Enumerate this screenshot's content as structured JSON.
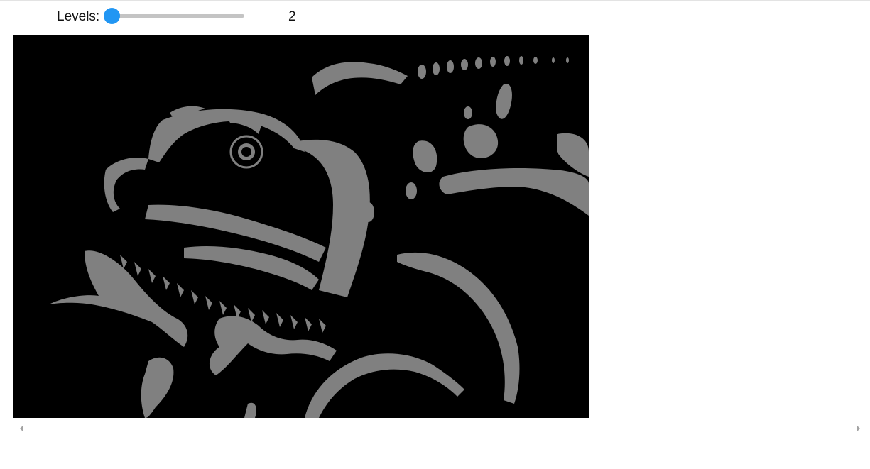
{
  "controls": {
    "levels_label": "Levels:",
    "levels_value": "2",
    "slider": {
      "min_level": 2,
      "value": 2
    }
  },
  "image": {
    "subject": "chameleon",
    "palette": {
      "background": "#000000",
      "foreground": "#808080"
    }
  },
  "scrollbar": {
    "left_icon": "arrow-left-icon",
    "right_icon": "arrow-right-icon"
  },
  "colors": {
    "accent": "#2196f3",
    "track": "#c4c4c4"
  }
}
